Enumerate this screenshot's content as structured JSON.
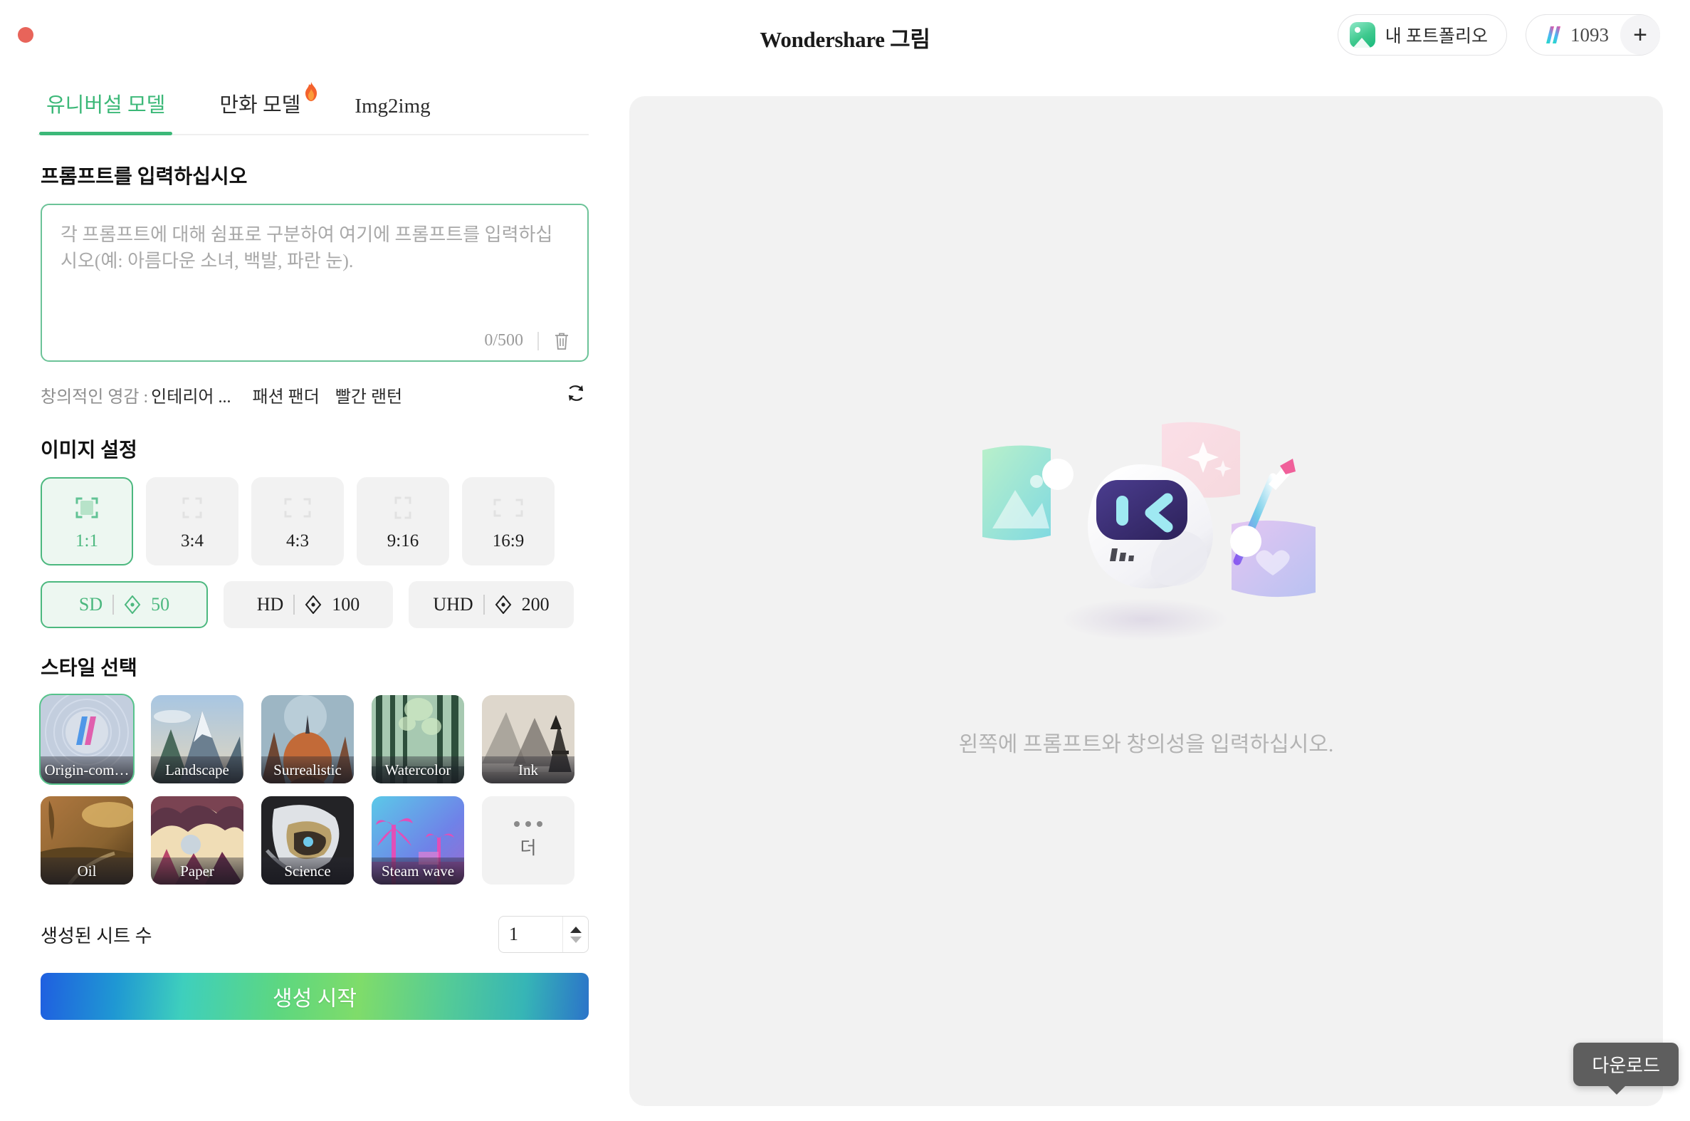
{
  "window": {
    "close_dot": "close-window"
  },
  "header": {
    "title": "Wondershare 그림",
    "portfolio_label": "내 포트폴리오",
    "credits_value": "1093",
    "add_credits_label": "+"
  },
  "tabs": [
    {
      "label": "유니버설 모델",
      "active": true,
      "badge": ""
    },
    {
      "label": "만화 모델",
      "active": false,
      "badge": "fire"
    },
    {
      "label": "Img2img",
      "active": false,
      "badge": ""
    }
  ],
  "prompt": {
    "section_title": "프롬프트를 입력하십시오",
    "placeholder": "각 프롬프트에 대해 쉼표로 구분하여 여기에 프롬프트를 입력하십시오(예: 아름다운 소녀, 백발, 파란 눈).",
    "value": "",
    "char_count": "0/500",
    "clear_icon": "trash-icon"
  },
  "inspiration": {
    "label": "창의적인 영감 :",
    "first": "인테리어 ...",
    "chips": [
      "패션 팬더",
      "빨간 랜턴"
    ],
    "refresh_icon": "refresh-icon"
  },
  "image_settings": {
    "section_title": "이미지 설정",
    "ratios": [
      {
        "label": "1:1",
        "selected": true
      },
      {
        "label": "3:4",
        "selected": false
      },
      {
        "label": "4:3",
        "selected": false
      },
      {
        "label": "9:16",
        "selected": false
      },
      {
        "label": "16:9",
        "selected": false
      }
    ],
    "qualities": [
      {
        "name": "SD",
        "cost": "50",
        "selected": true
      },
      {
        "name": "HD",
        "cost": "100",
        "selected": false
      },
      {
        "name": "UHD",
        "cost": "200",
        "selected": false
      }
    ]
  },
  "styles": {
    "section_title": "스타일 선택",
    "items": [
      {
        "name": "Origin-com…",
        "selected": true
      },
      {
        "name": "Landscape",
        "selected": false
      },
      {
        "name": "Surrealistic",
        "selected": false
      },
      {
        "name": "Watercolor",
        "selected": false
      },
      {
        "name": "Ink",
        "selected": false
      },
      {
        "name": "Oil",
        "selected": false
      },
      {
        "name": "Paper",
        "selected": false
      },
      {
        "name": "Science",
        "selected": false
      },
      {
        "name": "Steam wave",
        "selected": false
      }
    ],
    "more_label": "더"
  },
  "count": {
    "label": "생성된 시트 수",
    "value": "1"
  },
  "generate": {
    "label": "생성 시작"
  },
  "canvas": {
    "empty_text": "왼쪽에 프롬프트와 창의성을 입력하십시오.",
    "mascot_icon": "robot-mascot-illustration"
  },
  "tooltip": {
    "download_label": "다운로드"
  },
  "colors": {
    "accent_green": "#3cb878",
    "selected_bg": "#edf7f1",
    "canvas_bg": "#f2f2f2",
    "close_red": "#e8645a"
  }
}
